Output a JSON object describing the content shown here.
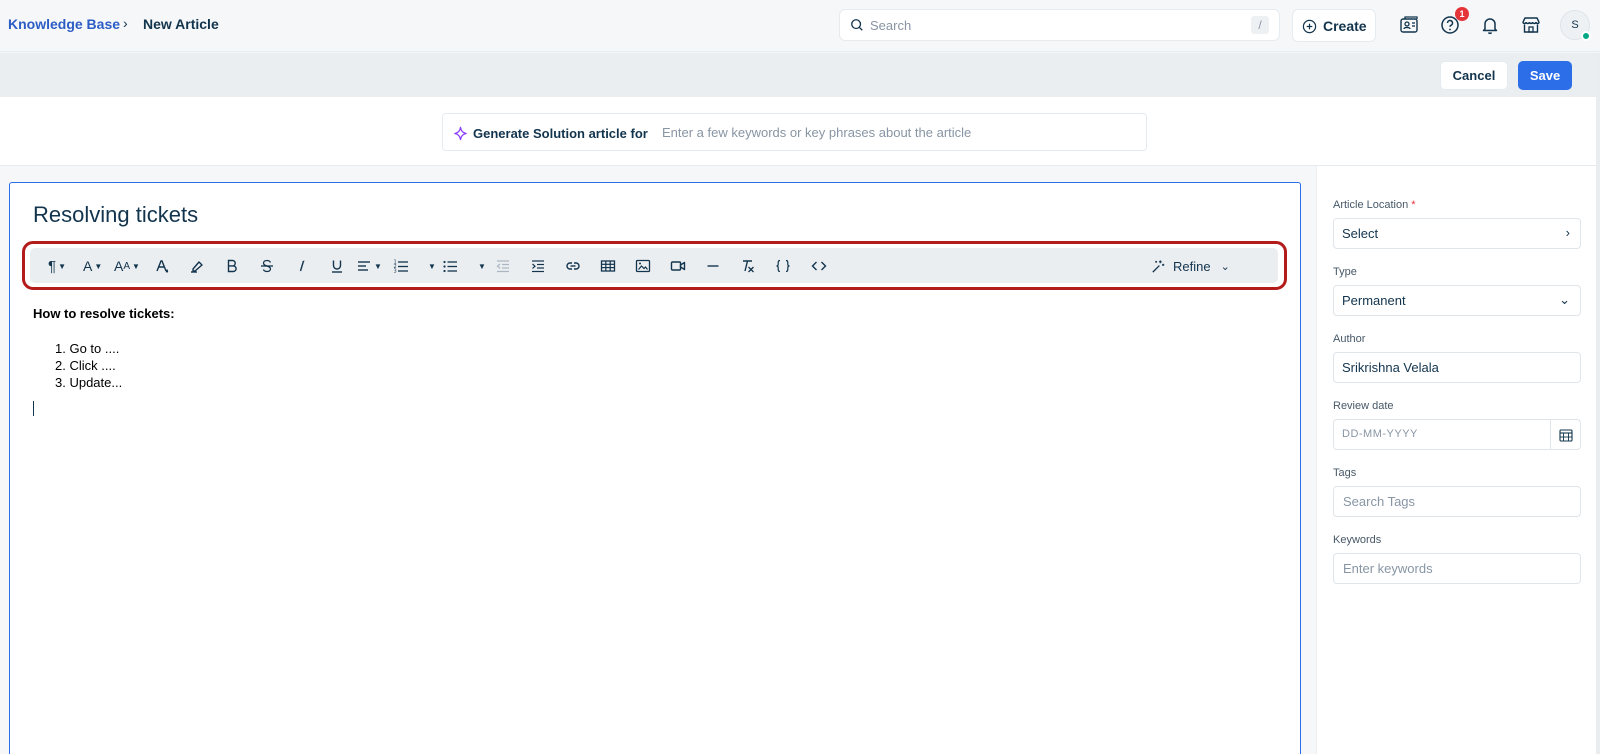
{
  "breadcrumb": {
    "root": "Knowledge Base",
    "separator": "›",
    "current": "New Article"
  },
  "search": {
    "placeholder": "Search",
    "shortcut": "/"
  },
  "create": {
    "label": "Create"
  },
  "notifications": {
    "help_badge": "1"
  },
  "user": {
    "avatar_initial": "S",
    "status_color": "#00a886"
  },
  "actions": {
    "cancel": "Cancel",
    "save": "Save"
  },
  "generate": {
    "label": "Generate Solution article for",
    "placeholder": "Enter a few keywords or key phrases about the article"
  },
  "editor": {
    "title": "Resolving tickets",
    "refine_label": "Refine",
    "content_heading": "How to resolve tickets:",
    "list_items": [
      "1. Go to ....",
      "2. Click ....",
      "3. Update..."
    ]
  },
  "sidebar": {
    "article_location": {
      "label": "Article Location",
      "required": "*",
      "value": "Select"
    },
    "type": {
      "label": "Type",
      "value": "Permanent"
    },
    "author": {
      "label": "Author",
      "value": "Srikrishna Velala"
    },
    "review_date": {
      "label": "Review date",
      "placeholder": "DD-MM-YYYY"
    },
    "tags": {
      "label": "Tags",
      "placeholder": "Search Tags"
    },
    "keywords": {
      "label": "Keywords",
      "placeholder": "Enter keywords"
    }
  },
  "colors": {
    "accent": "#2c6ee8",
    "link": "#2c5cc5",
    "highlight_border": "#b41c1c",
    "badge": "#e43538"
  }
}
